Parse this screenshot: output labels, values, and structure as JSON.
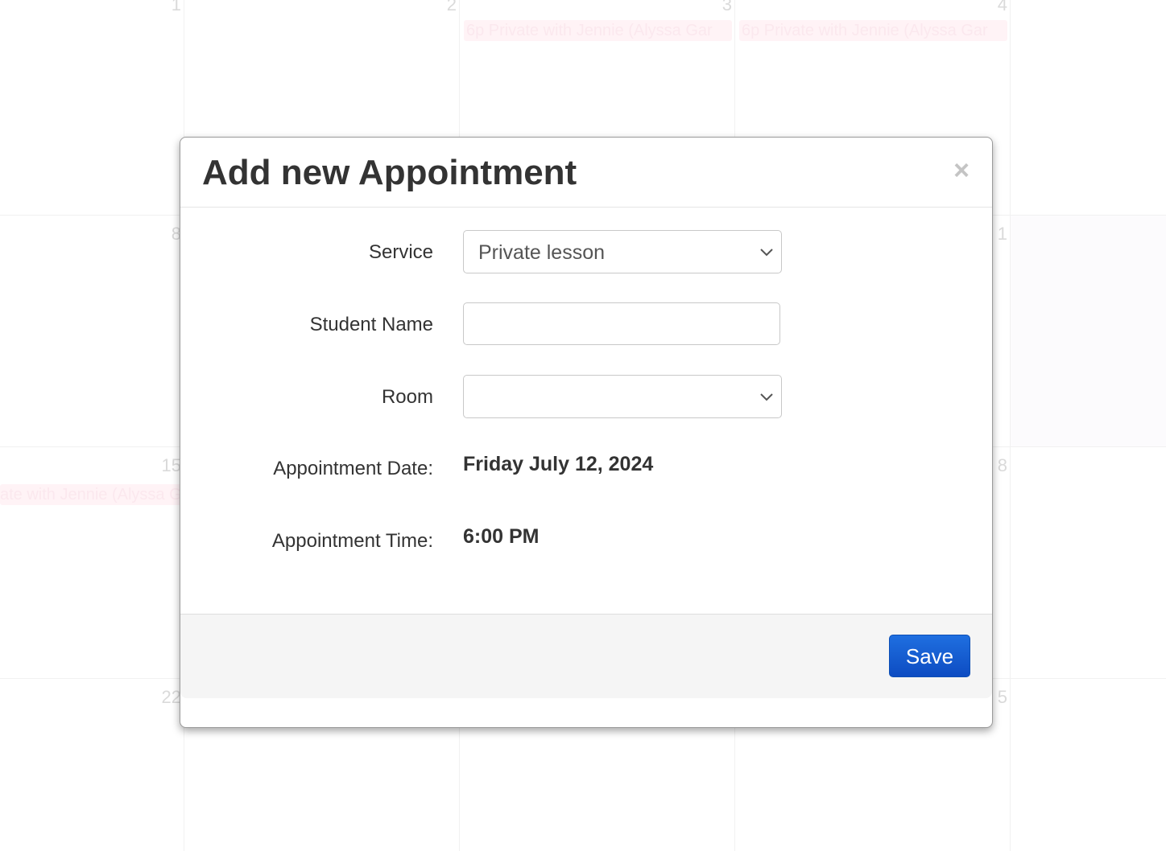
{
  "calendar": {
    "day_numbers": [
      "1",
      "2",
      "3",
      "4",
      "8",
      "1",
      "15",
      "8",
      "22",
      "5"
    ],
    "events": [
      "6p Private with Jennie (Alyssa Gar",
      "6p Private with Jennie (Alyssa Gar",
      "ate with Jennie (Alyssa G"
    ]
  },
  "modal": {
    "title": "Add new Appointment",
    "close_symbol": "×",
    "fields": {
      "service": {
        "label": "Service",
        "selected": "Private lesson",
        "icon": "chevron-down-icon"
      },
      "student_name": {
        "label": "Student Name",
        "value": "",
        "placeholder": ""
      },
      "room": {
        "label": "Room",
        "selected": "",
        "icon": "chevron-down-icon"
      },
      "appointment_date": {
        "label": "Appointment Date:",
        "value": "Friday July 12, 2024"
      },
      "appointment_time": {
        "label": "Appointment Time:",
        "value": "6:00 PM"
      }
    },
    "footer": {
      "save_label": "Save"
    }
  },
  "colors": {
    "primary_button": "#1a5fd6",
    "event_background": "#fff3f6"
  }
}
